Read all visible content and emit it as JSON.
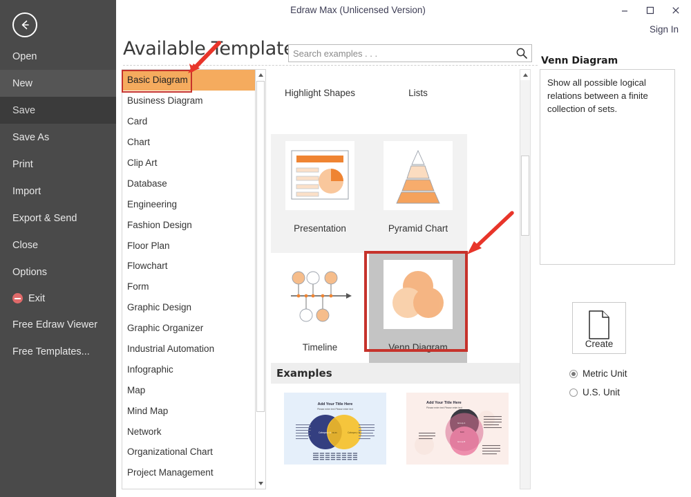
{
  "window": {
    "title": "Edraw Max (Unlicensed Version)",
    "minimize_label": "–",
    "maximize_label": "❐",
    "close_label": "✕",
    "sign_in_label": "Sign In"
  },
  "sidebar": {
    "back_icon": "back-arrow-icon",
    "items": [
      {
        "label": "Open",
        "state": "normal"
      },
      {
        "label": "New",
        "state": "hover"
      },
      {
        "label": "Save",
        "state": "selected"
      },
      {
        "label": "Save As",
        "state": "normal"
      },
      {
        "label": "Print",
        "state": "normal"
      },
      {
        "label": "Import",
        "state": "normal"
      },
      {
        "label": "Export & Send",
        "state": "normal"
      },
      {
        "label": "Close",
        "state": "normal"
      },
      {
        "label": "Options",
        "state": "normal"
      },
      {
        "label": "Exit",
        "state": "normal",
        "icon": "exit-icon"
      },
      {
        "label": "Free Edraw Viewer",
        "state": "normal"
      },
      {
        "label": "Free Templates...",
        "state": "normal"
      }
    ]
  },
  "header": {
    "page_title": "Available Templates",
    "search": {
      "placeholder": "Search examples . . .",
      "value": "",
      "icon": "search-icon"
    }
  },
  "categories": {
    "selected": "Basic Diagram",
    "items": [
      "Basic Diagram",
      "Business Diagram",
      "Card",
      "Chart",
      "Clip Art",
      "Database",
      "Engineering",
      "Fashion Design",
      "Floor Plan",
      "Flowchart",
      "Form",
      "Graphic Design",
      "Graphic Organizer",
      "Industrial Automation",
      "Infographic",
      "Map",
      "Mind Map",
      "Network",
      "Organizational Chart",
      "Project Management"
    ]
  },
  "templates": {
    "selected": "Venn Diagram",
    "items": [
      {
        "label": "Highlight Shapes",
        "thumb": "highlight-shapes-thumb",
        "selected": false
      },
      {
        "label": "Lists",
        "thumb": "lists-thumb",
        "selected": false
      },
      {
        "label": "Presentation",
        "thumb": "presentation-thumb",
        "selected": false
      },
      {
        "label": "Pyramid Chart",
        "thumb": "pyramid-chart-thumb",
        "selected": false
      },
      {
        "label": "Timeline",
        "thumb": "timeline-thumb",
        "selected": false
      },
      {
        "label": "Venn Diagram",
        "thumb": "venn-diagram-thumb",
        "selected": true
      }
    ]
  },
  "examples": {
    "title": "Examples",
    "items": [
      {
        "title": "Add Your Title Here",
        "subtitle": "Please enter text    Please enter text",
        "theme": "blue-yellow"
      },
      {
        "title": "Add Your Title Here",
        "subtitle": "Please enter text    Please enter text",
        "theme": "dark-pink"
      }
    ]
  },
  "info": {
    "title": "Venn Diagram",
    "description": "Show all possible logical relations between a finite collection of sets.",
    "create_label": "Create",
    "create_icon": "new-document-icon",
    "units": {
      "selected": "Metric Unit",
      "options": [
        "Metric Unit",
        "U.S. Unit"
      ]
    }
  },
  "colors": {
    "accent_orange": "#f5ab5e",
    "highlight_red": "#c6322b",
    "sidebar_bg": "#4a4a4a",
    "selection_gray": "#c4c4c4"
  },
  "annotations": [
    {
      "name": "arrow-to-basic-diagram",
      "color": "#e03020"
    },
    {
      "name": "arrow-to-venn-diagram",
      "color": "#e03020"
    }
  ]
}
